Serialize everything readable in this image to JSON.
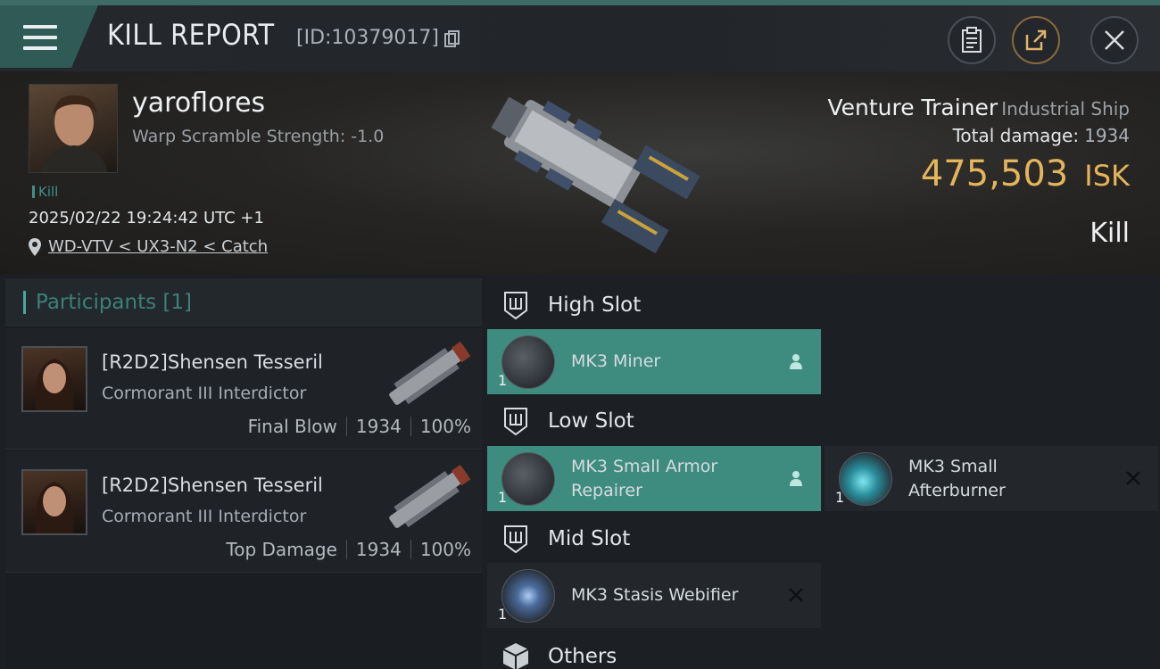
{
  "header": {
    "title": "KILL REPORT",
    "report_id": "[ID:10379017]"
  },
  "victim": {
    "pilot_name": "yaroflores",
    "warp_scramble": "Warp Scramble Strength: -1.0",
    "tag": "Kill",
    "datetime": "2025/02/22 19:24:42 UTC +1",
    "location": "WD-VTV < UX3-N2 < Catch",
    "ship_name": "Venture Trainer",
    "ship_class": "Industrial Ship",
    "total_damage_label": "Total damage:",
    "total_damage_value": "1934",
    "isk_value": "475,503",
    "isk_unit": "ISK",
    "result": "Kill"
  },
  "participants": {
    "title": "Participants",
    "count": "[1]",
    "rows": [
      {
        "name": "[R2D2]Shensen Tesseril",
        "ship": "Cormorant III Interdictor",
        "role": "Final Blow",
        "damage": "1934",
        "percent": "100%"
      },
      {
        "name": "[R2D2]Shensen Tesseril",
        "ship": "Cormorant III Interdictor",
        "role": "Top Damage",
        "damage": "1934",
        "percent": "100%"
      }
    ]
  },
  "slots": {
    "high": {
      "label": "High Slot",
      "modules": [
        {
          "name": "MK3 Miner",
          "qty": "1",
          "state": "fitted",
          "icon": "person-icon"
        }
      ]
    },
    "low": {
      "label": "Low Slot",
      "modules": [
        {
          "name_line1": "MK3 Small Armor",
          "name_line2": "Repairer",
          "qty": "1",
          "state": "fitted",
          "icon": "person-icon"
        },
        {
          "name_line1": "MK3 Small",
          "name_line2": "Afterburner",
          "qty": "1",
          "state": "destroyed",
          "icon": "close-icon"
        }
      ]
    },
    "mid": {
      "label": "Mid Slot",
      "modules": [
        {
          "name": "MK3 Stasis Webifier",
          "qty": "1",
          "state": "destroyed",
          "icon": "close-icon"
        }
      ]
    },
    "others": {
      "label": "Others"
    }
  },
  "colors": {
    "accent": "#3e8c80",
    "isk": "#e3b45a"
  }
}
